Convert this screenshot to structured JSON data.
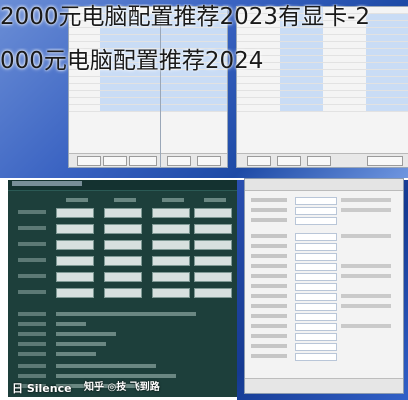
{
  "title": {
    "line1": "2000元电脑配置推荐2023有显卡-2",
    "line2": "000元电脑配置推荐2024"
  },
  "watermark": {
    "left": "日 Silence",
    "right": "知乎 ◎技 飞到路"
  },
  "colors": {
    "desktop_blue": "#1d4aa6",
    "aida_panel": "#1d3f3b",
    "window_bg": "#f4f4f4"
  }
}
